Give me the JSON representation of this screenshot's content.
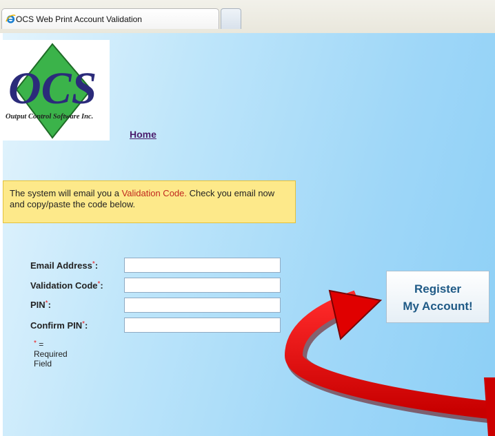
{
  "browser": {
    "tab_title": "OCS Web Print Account Validation"
  },
  "logo": {
    "initials": "OCS",
    "company": "Output Control Software Inc."
  },
  "nav": {
    "home": "Home"
  },
  "notice": {
    "part1": "The system will email you a ",
    "highlight": "Validation Code.",
    "part2": " Check you email now and copy/paste the code below."
  },
  "form": {
    "required_marker": "*",
    "email_label": "Email Address",
    "validation_label": "Validation Code",
    "pin_label": "PIN",
    "confirm_pin_label": "Confirm PIN",
    "label_colon": ":",
    "email_value": "",
    "validation_value": "",
    "pin_value": "",
    "confirm_pin_value": "",
    "required_note": "= Required Field"
  },
  "register": {
    "line1": "Register",
    "line2": "My Account!"
  },
  "colors": {
    "required": "#e11111",
    "highlight": "#c0281e",
    "button_text": "#1f5a86",
    "arrow": "#e00000"
  }
}
